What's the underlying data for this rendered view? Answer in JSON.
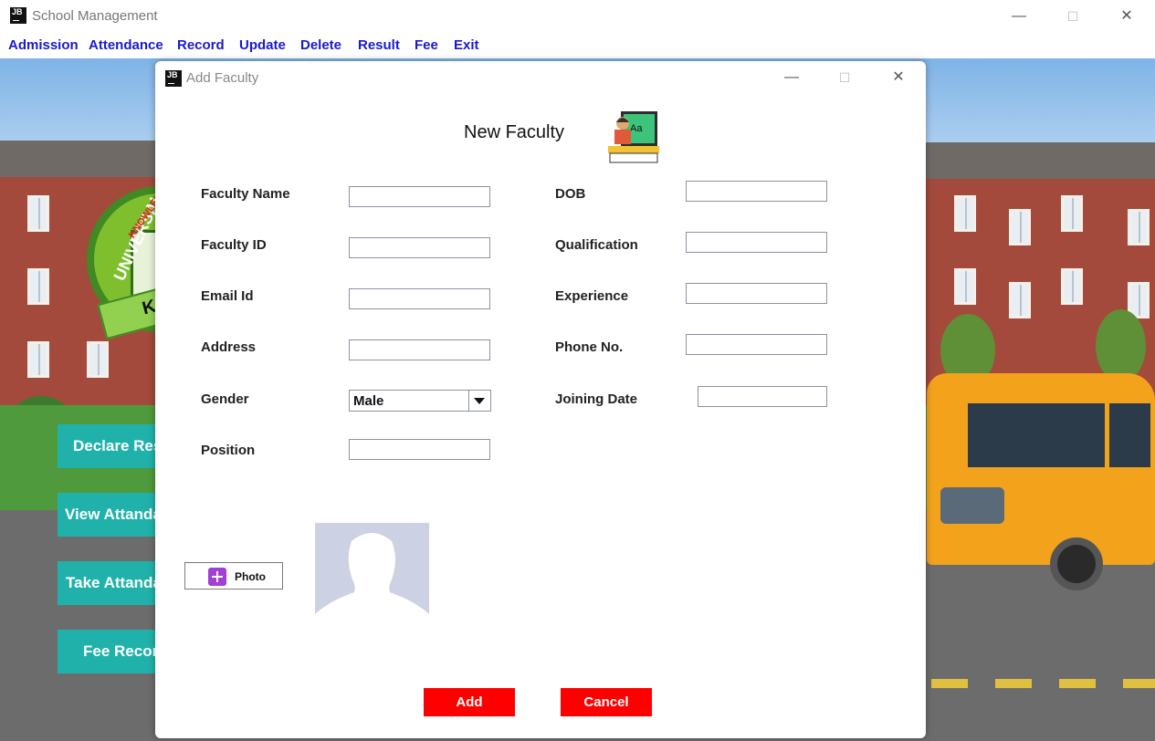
{
  "app": {
    "title": "School Management",
    "logo_text": "JB"
  },
  "window_controls": {
    "minimize": "—",
    "maximize": "☐",
    "close": "✕"
  },
  "menu": [
    "Admission",
    "Attendance",
    "Record",
    "Update",
    "Delete",
    "Result",
    "Fee",
    "Exit"
  ],
  "background": {
    "logo_text": "UNIVERSAL",
    "logo_subtext": "KNOWLEDGE",
    "logo_initials": "K",
    "side_buttons": [
      "Declare Result",
      "View Attandance",
      "Take Attandance",
      "Fee Record"
    ]
  },
  "dialog": {
    "title": "Add Faculty",
    "heading": "New Faculty",
    "left_fields": [
      {
        "label": "Faculty Name",
        "value": ""
      },
      {
        "label": "Faculty ID",
        "value": ""
      },
      {
        "label": "Email Id",
        "value": ""
      },
      {
        "label": "Address",
        "value": ""
      }
    ],
    "gender": {
      "label": "Gender",
      "selected": "Male"
    },
    "position": {
      "label": "Position",
      "value": ""
    },
    "right_fields": [
      {
        "label": "DOB",
        "value": ""
      },
      {
        "label": "Qualification",
        "value": ""
      },
      {
        "label": "Experience",
        "value": ""
      },
      {
        "label": "Phone No.",
        "value": ""
      },
      {
        "label": "Joining Date",
        "value": ""
      }
    ],
    "photo_button": "Photo",
    "buttons": {
      "add": "Add",
      "cancel": "Cancel"
    },
    "colors": {
      "action_button": "#ff0000",
      "menu_text": "#1a1acc",
      "side_button": "#20b2aa"
    }
  }
}
